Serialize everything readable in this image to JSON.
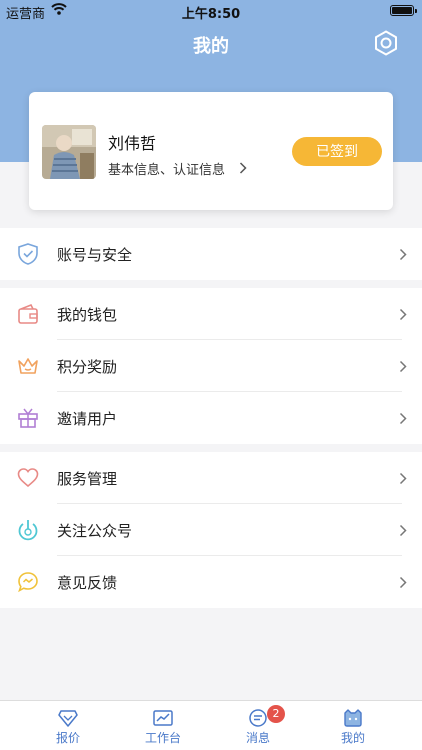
{
  "status_bar": {
    "carrier": "运营商",
    "time": "上午8:50"
  },
  "header": {
    "title": "我的",
    "settings_icon": "settings-hexagon-icon",
    "background": "#8db4e2"
  },
  "profile": {
    "name": "刘伟哲",
    "subtitle": "基本信息、认证信息",
    "checkin_label": "已签到",
    "checkin_color": "#f6b736"
  },
  "menu": {
    "account_security": {
      "label": "账号与安全",
      "icon": "shield-icon"
    },
    "wallet": {
      "label": "我的钱包",
      "icon": "wallet-icon"
    },
    "points": {
      "label": "积分奖励",
      "icon": "crown-icon"
    },
    "invite": {
      "label": "邀请用户",
      "icon": "gift-icon"
    },
    "service": {
      "label": "服务管理",
      "icon": "heart-icon"
    },
    "follow": {
      "label": "关注公众号",
      "icon": "power-icon"
    },
    "feedback": {
      "label": "意见反馈",
      "icon": "chat-bubble-icon"
    }
  },
  "tabbar": {
    "tabs": [
      {
        "label": "报价",
        "icon": "diamond-icon"
      },
      {
        "label": "工作台",
        "icon": "chart-icon"
      },
      {
        "label": "消息",
        "icon": "message-icon",
        "badge": "2"
      },
      {
        "label": "我的",
        "icon": "cat-face-icon"
      }
    ],
    "active_color": "#4a79c9"
  }
}
